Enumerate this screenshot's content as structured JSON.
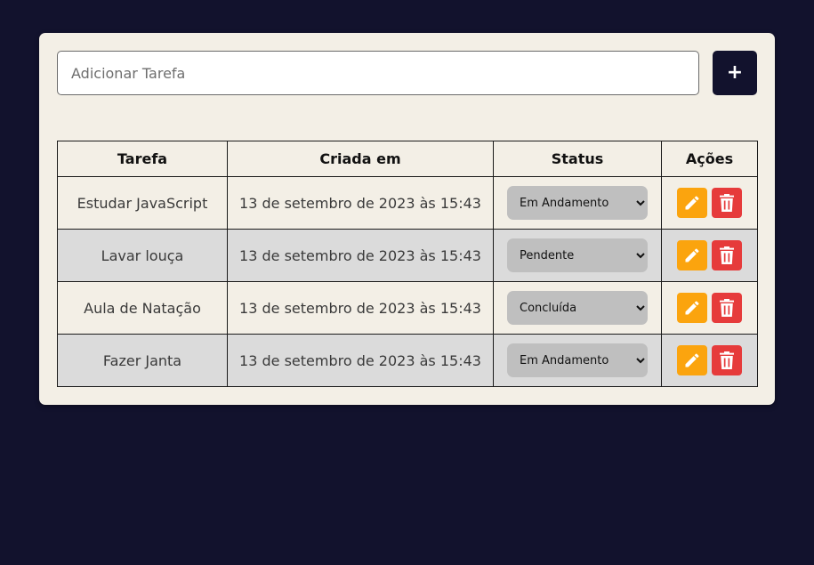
{
  "form": {
    "input_value": "",
    "input_placeholder": "Adicionar Tarefa",
    "add_button_label": "+"
  },
  "table": {
    "headers": [
      "Tarefa",
      "Criada em",
      "Status",
      "Ações"
    ],
    "rows": [
      {
        "task": "Estudar JavaScript",
        "created": "13 de setembro de 2023 às 15:43",
        "status": "Em Andamento"
      },
      {
        "task": "Lavar louça",
        "created": "13 de setembro de 2023 às 15:43",
        "status": "Pendente"
      },
      {
        "task": "Aula de Natação",
        "created": "13 de setembro de 2023 às 15:43",
        "status": "Concluída"
      },
      {
        "task": "Fazer Janta",
        "created": "13 de setembro de 2023 às 15:43",
        "status": "Em Andamento"
      }
    ]
  },
  "icons": {
    "edit": "pencil-icon",
    "delete": "trash-icon"
  },
  "colors": {
    "background": "#12122d",
    "card": "#f3efe6",
    "row_alt": "#dbdbdb",
    "edit_button": "#fba40e",
    "delete_button": "#e63b3b",
    "add_button": "#12122d"
  }
}
